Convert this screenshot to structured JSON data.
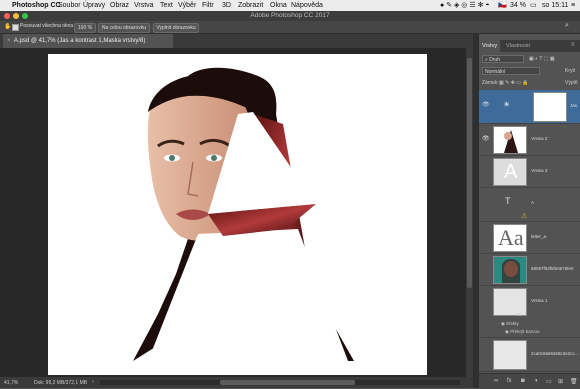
{
  "menubar": {
    "apple": "",
    "app_name": "Photoshop CC",
    "items": [
      "Soubor",
      "Úpravy",
      "Obraz",
      "Vrstva",
      "Text",
      "Výběr",
      "Filtr",
      "3D",
      "Zobrazit",
      "Okna",
      "Nápověda"
    ],
    "battery": "34 %",
    "flag": "🇨🇿",
    "day_time": "so 15:11"
  },
  "window": {
    "title": "Adobe Photoshop CC 2017"
  },
  "options_bar": {
    "checkbox_label": "Posouvat všechna okna",
    "zoom_label": "100 %",
    "fit_screen_label": "Na celou obrazovku",
    "fill_screen_label": "Vyplnit obrazovku"
  },
  "document": {
    "tab_label": "A.psd @ 41,7% (Jas a kontrast 1,Maska vrstvy/8)",
    "zoom": "41,7%",
    "doc_size": "Dok: 99,2 MB/372,1 MB"
  },
  "panel": {
    "tabs": [
      "Vrstvy",
      "Vlastnosti"
    ],
    "filter_label": "Druh",
    "blend_mode": "Normální",
    "opacity_label": "Krytí",
    "lock_label": "Zámek:",
    "fill_label": "Výplň",
    "layers": [
      {
        "name": "Jas",
        "visible": true,
        "selected": true
      },
      {
        "name": "Vrstva 2",
        "visible": true
      },
      {
        "name": "Vrstva 3",
        "visible": false
      },
      {
        "name": "A",
        "visible": false
      },
      {
        "name": "letter_a",
        "visible": false
      },
      {
        "name": "58097f63f5fe0576fe0",
        "visible": false
      },
      {
        "name": "Vrstva 1",
        "visible": false
      },
      {
        "name": "2ca0c9a663e8c3e2cc...",
        "visible": false
      }
    ],
    "effects_label": "Efekty",
    "color_overlay_label": "Překrýt barvou",
    "warning": "⚠",
    "text_icon": "T",
    "fx_label": "fx"
  },
  "colors": {
    "accent": "#3e6b99",
    "canvas_bg": "#ffffff",
    "workspace": "#282828"
  }
}
